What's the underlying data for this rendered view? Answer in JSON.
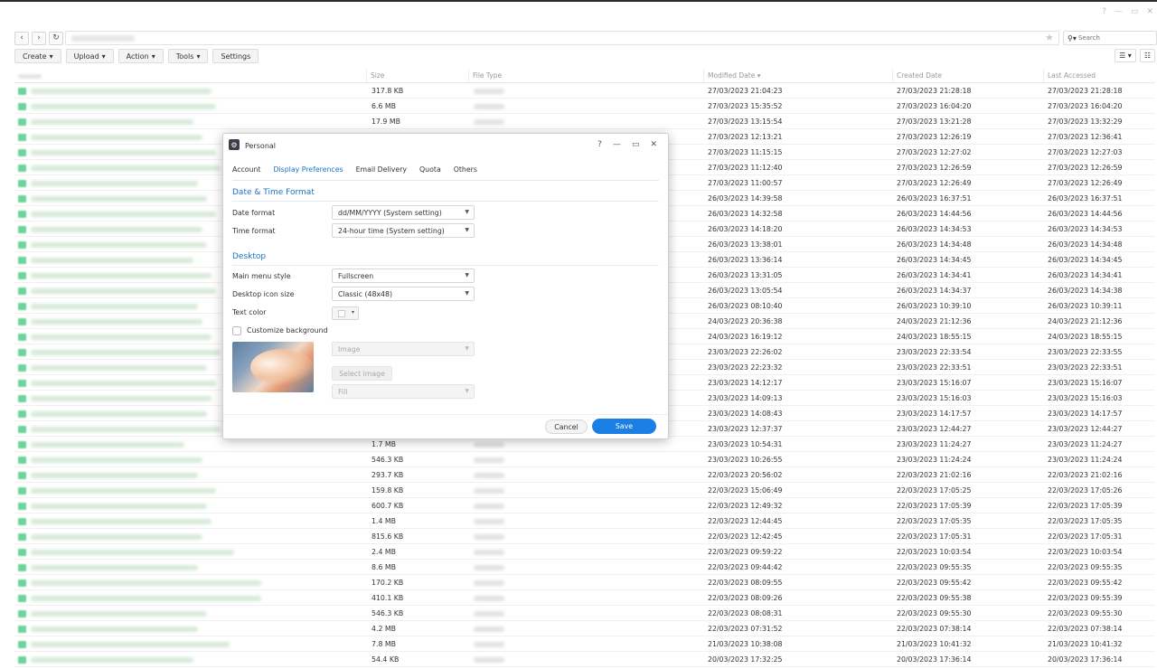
{
  "window": {
    "controls": [
      "?",
      "—",
      "▭",
      "✕"
    ]
  },
  "nav": {
    "back": "‹",
    "forward": "›",
    "refresh": "↻"
  },
  "search": {
    "placeholder": "Search"
  },
  "toolbar": {
    "create": "Create",
    "upload": "Upload",
    "action": "Action",
    "tools": "Tools",
    "settings": "Settings"
  },
  "columns": {
    "size": "Size",
    "file_type": "File Type",
    "modified": "Modified Date",
    "created": "Created Date",
    "accessed": "Last Accessed"
  },
  "rows": [
    {
      "size": "317.8 KB",
      "modified": "27/03/2023 21:04:23",
      "created": "27/03/2023 21:28:18",
      "accessed": "27/03/2023 21:28:18"
    },
    {
      "size": "6.6 MB",
      "modified": "27/03/2023 15:35:52",
      "created": "27/03/2023 16:04:20",
      "accessed": "27/03/2023 16:04:20"
    },
    {
      "size": "17.9 MB",
      "modified": "27/03/2023 13:15:54",
      "created": "27/03/2023 13:21:28",
      "accessed": "27/03/2023 13:32:29"
    },
    {
      "size": "",
      "modified": "27/03/2023 12:13:21",
      "created": "27/03/2023 12:26:19",
      "accessed": "27/03/2023 12:36:41"
    },
    {
      "size": "",
      "modified": "27/03/2023 11:15:15",
      "created": "27/03/2023 12:27:02",
      "accessed": "27/03/2023 12:27:03"
    },
    {
      "size": "",
      "modified": "27/03/2023 11:12:40",
      "created": "27/03/2023 12:26:59",
      "accessed": "27/03/2023 12:26:59"
    },
    {
      "size": "",
      "modified": "27/03/2023 11:00:57",
      "created": "27/03/2023 12:26:49",
      "accessed": "27/03/2023 12:26:49"
    },
    {
      "size": "",
      "modified": "26/03/2023 14:39:58",
      "created": "26/03/2023 16:37:51",
      "accessed": "26/03/2023 16:37:51"
    },
    {
      "size": "",
      "modified": "26/03/2023 14:32:58",
      "created": "26/03/2023 14:44:56",
      "accessed": "26/03/2023 14:44:56"
    },
    {
      "size": "",
      "modified": "26/03/2023 14:18:20",
      "created": "26/03/2023 14:34:53",
      "accessed": "26/03/2023 14:34:53"
    },
    {
      "size": "",
      "modified": "26/03/2023 13:38:01",
      "created": "26/03/2023 14:34:48",
      "accessed": "26/03/2023 14:34:48"
    },
    {
      "size": "",
      "modified": "26/03/2023 13:36:14",
      "created": "26/03/2023 14:34:45",
      "accessed": "26/03/2023 14:34:45"
    },
    {
      "size": "",
      "modified": "26/03/2023 13:31:05",
      "created": "26/03/2023 14:34:41",
      "accessed": "26/03/2023 14:34:41"
    },
    {
      "size": "",
      "modified": "26/03/2023 13:05:54",
      "created": "26/03/2023 14:34:37",
      "accessed": "26/03/2023 14:34:38"
    },
    {
      "size": "",
      "modified": "26/03/2023 08:10:40",
      "created": "26/03/2023 10:39:10",
      "accessed": "26/03/2023 10:39:11"
    },
    {
      "size": "",
      "modified": "24/03/2023 20:36:38",
      "created": "24/03/2023 21:12:36",
      "accessed": "24/03/2023 21:12:36"
    },
    {
      "size": "",
      "modified": "24/03/2023 16:19:12",
      "created": "24/03/2023 18:55:15",
      "accessed": "24/03/2023 18:55:15"
    },
    {
      "size": "",
      "modified": "23/03/2023 22:26:02",
      "created": "23/03/2023 22:33:54",
      "accessed": "23/03/2023 22:33:55"
    },
    {
      "size": "",
      "modified": "23/03/2023 22:23:32",
      "created": "23/03/2023 22:33:51",
      "accessed": "23/03/2023 22:33:51"
    },
    {
      "size": "",
      "modified": "23/03/2023 14:12:17",
      "created": "23/03/2023 15:16:07",
      "accessed": "23/03/2023 15:16:07"
    },
    {
      "size": "",
      "modified": "23/03/2023 14:09:13",
      "created": "23/03/2023 15:16:03",
      "accessed": "23/03/2023 15:16:03"
    },
    {
      "size": "",
      "modified": "23/03/2023 14:08:43",
      "created": "23/03/2023 14:17:57",
      "accessed": "23/03/2023 14:17:57"
    },
    {
      "size": "",
      "modified": "23/03/2023 12:37:37",
      "created": "23/03/2023 12:44:27",
      "accessed": "23/03/2023 12:44:27"
    },
    {
      "size": "1.7 MB",
      "modified": "23/03/2023 10:54:31",
      "created": "23/03/2023 11:24:27",
      "accessed": "23/03/2023 11:24:27"
    },
    {
      "size": "546.3 KB",
      "modified": "23/03/2023 10:26:55",
      "created": "23/03/2023 11:24:24",
      "accessed": "23/03/2023 11:24:24"
    },
    {
      "size": "293.7 KB",
      "modified": "22/03/2023 20:56:02",
      "created": "22/03/2023 21:02:16",
      "accessed": "22/03/2023 21:02:16"
    },
    {
      "size": "159.8 KB",
      "modified": "22/03/2023 15:06:49",
      "created": "22/03/2023 17:05:25",
      "accessed": "22/03/2023 17:05:26"
    },
    {
      "size": "600.7 KB",
      "modified": "22/03/2023 12:49:32",
      "created": "22/03/2023 17:05:39",
      "accessed": "22/03/2023 17:05:39"
    },
    {
      "size": "1.4 MB",
      "modified": "22/03/2023 12:44:45",
      "created": "22/03/2023 17:05:35",
      "accessed": "22/03/2023 17:05:35"
    },
    {
      "size": "815.6 KB",
      "modified": "22/03/2023 12:42:45",
      "created": "22/03/2023 17:05:31",
      "accessed": "22/03/2023 17:05:31"
    },
    {
      "size": "2.4 MB",
      "modified": "22/03/2023 09:59:22",
      "created": "22/03/2023 10:03:54",
      "accessed": "22/03/2023 10:03:54"
    },
    {
      "size": "8.6 MB",
      "modified": "22/03/2023 09:44:42",
      "created": "22/03/2023 09:55:35",
      "accessed": "22/03/2023 09:55:35"
    },
    {
      "size": "170.2 KB",
      "modified": "22/03/2023 08:09:55",
      "created": "22/03/2023 09:55:42",
      "accessed": "22/03/2023 09:55:42"
    },
    {
      "size": "410.1 KB",
      "modified": "22/03/2023 08:09:26",
      "created": "22/03/2023 09:55:38",
      "accessed": "22/03/2023 09:55:39"
    },
    {
      "size": "546.3 KB",
      "modified": "22/03/2023 08:08:31",
      "created": "22/03/2023 09:55:30",
      "accessed": "22/03/2023 09:55:30"
    },
    {
      "size": "4.2 MB",
      "modified": "22/03/2023 07:31:52",
      "created": "22/03/2023 07:38:14",
      "accessed": "22/03/2023 07:38:14"
    },
    {
      "size": "7.8 MB",
      "modified": "21/03/2023 10:38:08",
      "created": "21/03/2023 10:41:32",
      "accessed": "21/03/2023 10:41:32"
    },
    {
      "size": "54.4 KB",
      "modified": "20/03/2023 17:32:25",
      "created": "20/03/2023 17:36:14",
      "accessed": "20/03/2023 17:36:14"
    }
  ],
  "dialog": {
    "title": "Personal",
    "controls": [
      "?",
      "—",
      "▭",
      "✕"
    ],
    "tabs": [
      "Account",
      "Display Preferences",
      "Email Delivery",
      "Quota",
      "Others"
    ],
    "active_tab": "Display Preferences",
    "section_datetime": "Date & Time Format",
    "date_format_label": "Date format",
    "date_format_value": "dd/MM/YYYY (System setting)",
    "time_format_label": "Time format",
    "time_format_value": "24-hour time (System setting)",
    "section_desktop": "Desktop",
    "main_menu_label": "Main menu style",
    "main_menu_value": "Fullscreen",
    "icon_size_label": "Desktop icon size",
    "icon_size_value": "Classic (48x48)",
    "text_color_label": "Text color",
    "customize_bg_label": "Customize background",
    "image_select_value": "Image",
    "select_image_button": "Select image",
    "fill_select_value": "Fill",
    "cancel": "Cancel",
    "save": "Save"
  },
  "colors": {
    "accent": "#1a80e5",
    "section": "#1a73c9",
    "file_icon": "#6bd39b"
  }
}
